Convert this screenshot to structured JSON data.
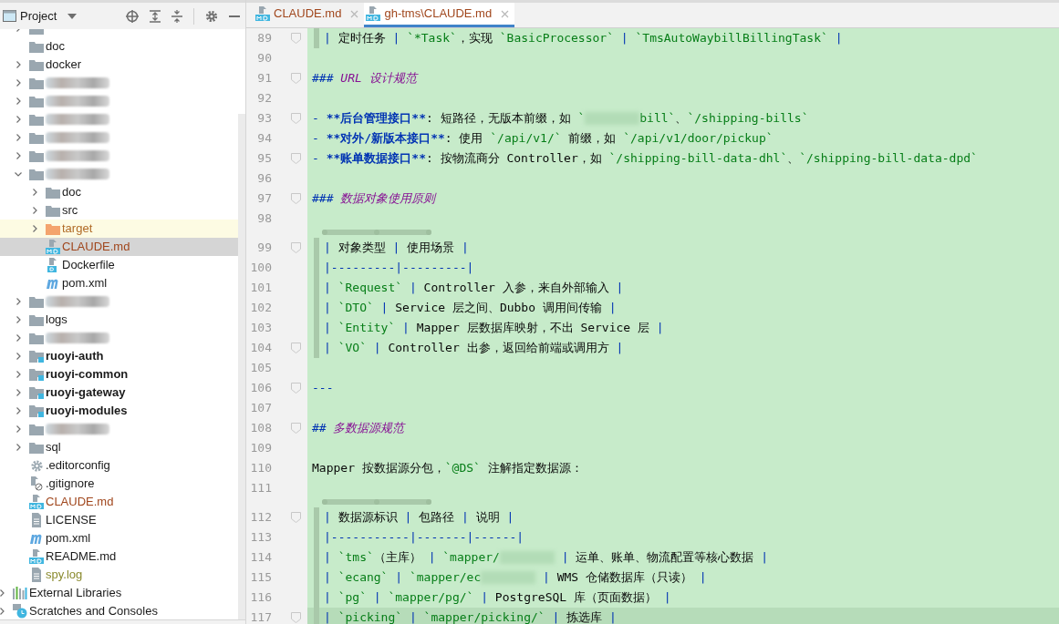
{
  "project_panel": {
    "title": "Project"
  },
  "tree": {
    "project_children": [
      {
        "kind": "folder",
        "expanded": false,
        "selected": false,
        "highlighted": false
      },
      {
        "label": "doc",
        "kind": "folder",
        "selected": false,
        "highlighted": false
      },
      {
        "label": "docker",
        "kind": "folder",
        "expanded": false,
        "selected": false,
        "highlighted": false
      },
      {
        "kind": "redacted",
        "expanded": false,
        "selected": false,
        "highlighted": false
      },
      {
        "kind": "redacted",
        "expanded": false,
        "selected": false,
        "highlighted": false
      },
      {
        "kind": "redacted",
        "expanded": false,
        "selected": false,
        "highlighted": false
      },
      {
        "kind": "redacted",
        "expanded": false,
        "selected": false,
        "highlighted": false
      },
      {
        "kind": "redacted",
        "expanded": false,
        "selected": false,
        "highlighted": false
      },
      {
        "kind": "redacted",
        "expanded": true,
        "selected": false,
        "highlighted": false,
        "children": [
          {
            "label": "doc",
            "kind": "folder",
            "expanded": false,
            "selected": false,
            "highlighted": false
          },
          {
            "label": "src",
            "kind": "folder",
            "expanded": false,
            "selected": false,
            "highlighted": false
          },
          {
            "label": "target",
            "kind": "excluded-folder",
            "expanded": false,
            "selected": false,
            "highlighted": true,
            "color": "#b06a25"
          },
          {
            "label": "CLAUDE.md",
            "kind": "markdown",
            "selected": true,
            "highlighted": false,
            "color": "#a0461c"
          },
          {
            "label": "Dockerfile",
            "kind": "docker",
            "selected": false,
            "highlighted": false
          },
          {
            "label": "pom.xml",
            "kind": "maven",
            "selected": false,
            "highlighted": false
          }
        ]
      },
      {
        "kind": "redacted",
        "expanded": false,
        "selected": false,
        "highlighted": false
      },
      {
        "label": "logs",
        "kind": "folder",
        "expanded": false,
        "selected": false,
        "highlighted": false
      },
      {
        "kind": "redacted",
        "expanded": false,
        "selected": false,
        "highlighted": false
      },
      {
        "label": "ruoyi-auth",
        "kind": "module",
        "expanded": false,
        "selected": false,
        "highlighted": false
      },
      {
        "label": "ruoyi-common",
        "kind": "module",
        "expanded": false,
        "selected": false,
        "highlighted": false
      },
      {
        "label": "ruoyi-gateway",
        "kind": "module",
        "expanded": false,
        "selected": false,
        "highlighted": false
      },
      {
        "label": "ruoyi-modules",
        "kind": "module",
        "expanded": false,
        "selected": false,
        "highlighted": false
      },
      {
        "kind": "redacted",
        "expanded": false,
        "selected": false,
        "highlighted": false
      },
      {
        "label": "sql",
        "kind": "folder",
        "expanded": false,
        "selected": false,
        "highlighted": false
      },
      {
        "label": ".editorconfig",
        "kind": "config",
        "selected": false,
        "highlighted": false
      },
      {
        "label": ".gitignore",
        "kind": "ignore",
        "selected": false,
        "highlighted": false
      },
      {
        "label": "CLAUDE.md",
        "kind": "markdown",
        "selected": false,
        "highlighted": false,
        "color": "#a0461c"
      },
      {
        "label": "LICENSE",
        "kind": "text",
        "selected": false,
        "highlighted": false
      },
      {
        "label": "pom.xml",
        "kind": "maven",
        "selected": false,
        "highlighted": false
      },
      {
        "label": "README.md",
        "kind": "markdown",
        "selected": false,
        "highlighted": false
      },
      {
        "label": "spy.log",
        "kind": "text",
        "selected": false,
        "highlighted": false,
        "color": "#8a8a2e"
      }
    ],
    "other_roots": [
      {
        "label": "External Libraries",
        "kind": "libraries",
        "expanded": false,
        "selected": false,
        "highlighted": false
      },
      {
        "label": "Scratches and Consoles",
        "kind": "scratches",
        "expanded": false,
        "selected": false,
        "highlighted": false
      }
    ]
  },
  "tabs": [
    {
      "label": "CLAUDE.md",
      "selected": false
    },
    {
      "label": "gh-tms\\CLAUDE.md",
      "selected": true
    }
  ],
  "editor": {
    "lines": [
      {
        "number": "89",
        "table": true,
        "table_start": false,
        "fold": true,
        "current": false,
        "segments": [
          {
            "kind": "pipe",
            "text": "| "
          },
          {
            "kind": "text",
            "text": "定时任务 "
          },
          {
            "kind": "pipe",
            "text": "| "
          },
          {
            "kind": "code",
            "text": "`*Task`"
          },
          {
            "kind": "text",
            "text": "，实现 "
          },
          {
            "kind": "code",
            "text": "`BasicProcessor`"
          },
          {
            "kind": "pipe",
            "text": " | "
          },
          {
            "kind": "code",
            "text": "`TmsAutoWaybillBillingTask`"
          },
          {
            "kind": "pipe",
            "text": " |"
          }
        ]
      },
      {
        "number": "90",
        "table": false,
        "table_start": false,
        "fold": false,
        "current": false
      },
      {
        "number": "91",
        "table": false,
        "table_start": false,
        "fold": true,
        "current": false,
        "segments": [
          {
            "kind": "hash",
            "text": "### "
          },
          {
            "kind": "heading",
            "text": "URL 设计规范"
          }
        ]
      },
      {
        "number": "92",
        "table": false,
        "table_start": false,
        "fold": false,
        "current": false
      },
      {
        "number": "93",
        "table": false,
        "table_start": false,
        "fold": true,
        "current": false,
        "segments": [
          {
            "kind": "hash",
            "text": "- "
          },
          {
            "kind": "strong",
            "text": "**后台管理接口**"
          },
          {
            "kind": "text",
            "text": ": 短路径，无版本前缀，如 "
          },
          {
            "kind": "code",
            "text": "`"
          },
          {
            "kind": "redacted"
          },
          {
            "kind": "code",
            "text": "bill`"
          },
          {
            "kind": "text",
            "text": "、"
          },
          {
            "kind": "code",
            "text": "`/shipping-bills`"
          }
        ]
      },
      {
        "number": "94",
        "table": false,
        "table_start": false,
        "fold": false,
        "current": false,
        "segments": [
          {
            "kind": "hash",
            "text": "- "
          },
          {
            "kind": "strong",
            "text": "**对外/新版本接口**"
          },
          {
            "kind": "text",
            "text": ": 使用 "
          },
          {
            "kind": "code",
            "text": "`/api/v1/`"
          },
          {
            "kind": "text",
            "text": " 前缀，如 "
          },
          {
            "kind": "code",
            "text": "`/api/v1/door/pickup`"
          }
        ]
      },
      {
        "number": "95",
        "table": false,
        "table_start": false,
        "fold": true,
        "current": false,
        "segments": [
          {
            "kind": "hash",
            "text": "- "
          },
          {
            "kind": "strong",
            "text": "**账单数据接口**"
          },
          {
            "kind": "text",
            "text": ": 按物流商分 Controller，如 "
          },
          {
            "kind": "code",
            "text": "`/shipping-bill-data-dhl`"
          },
          {
            "kind": "text",
            "text": "、"
          },
          {
            "kind": "code",
            "text": "`/shipping-bill-data-dpd`"
          }
        ]
      },
      {
        "number": "96",
        "table": false,
        "table_start": false,
        "fold": false,
        "current": false
      },
      {
        "number": "97",
        "table": false,
        "table_start": false,
        "fold": true,
        "current": false,
        "segments": [
          {
            "kind": "hash",
            "text": "### "
          },
          {
            "kind": "heading",
            "text": "数据对象使用原则"
          }
        ]
      },
      {
        "number": "98",
        "table": false,
        "table_start": false,
        "fold": false,
        "current": false
      },
      {
        "number": "99",
        "table": true,
        "table_start": true,
        "fold": true,
        "current": false,
        "segments": [
          {
            "kind": "pipe",
            "text": "| "
          },
          {
            "kind": "text",
            "text": "对象类型 "
          },
          {
            "kind": "pipe",
            "text": "| "
          },
          {
            "kind": "text",
            "text": "使用场景 "
          },
          {
            "kind": "pipe",
            "text": "|"
          }
        ]
      },
      {
        "number": "100",
        "table": true,
        "table_start": false,
        "fold": false,
        "current": false,
        "segments": [
          {
            "kind": "pipe",
            "text": "|---------|---------|"
          }
        ]
      },
      {
        "number": "101",
        "table": true,
        "table_start": false,
        "fold": false,
        "current": false,
        "segments": [
          {
            "kind": "pipe",
            "text": "| "
          },
          {
            "kind": "code",
            "text": "`Request`"
          },
          {
            "kind": "pipe",
            "text": " | "
          },
          {
            "kind": "text",
            "text": "Controller 入参，来自外部输入 "
          },
          {
            "kind": "pipe",
            "text": "|"
          }
        ]
      },
      {
        "number": "102",
        "table": true,
        "table_start": false,
        "fold": false,
        "current": false,
        "segments": [
          {
            "kind": "pipe",
            "text": "| "
          },
          {
            "kind": "code",
            "text": "`DTO`"
          },
          {
            "kind": "pipe",
            "text": " | "
          },
          {
            "kind": "text",
            "text": "Service 层之间、Dubbo 调用间传输 "
          },
          {
            "kind": "pipe",
            "text": "|"
          }
        ]
      },
      {
        "number": "103",
        "table": true,
        "table_start": false,
        "fold": false,
        "current": false,
        "segments": [
          {
            "kind": "pipe",
            "text": "| "
          },
          {
            "kind": "code",
            "text": "`Entity`"
          },
          {
            "kind": "pipe",
            "text": " | "
          },
          {
            "kind": "text",
            "text": "Mapper 层数据库映射，不出 Service 层 "
          },
          {
            "kind": "pipe",
            "text": "|"
          }
        ]
      },
      {
        "number": "104",
        "table": true,
        "table_start": false,
        "fold": true,
        "current": false,
        "segments": [
          {
            "kind": "pipe",
            "text": "| "
          },
          {
            "kind": "code",
            "text": "`VO`"
          },
          {
            "kind": "pipe",
            "text": " | "
          },
          {
            "kind": "text",
            "text": "Controller 出参，返回给前端或调用方 "
          },
          {
            "kind": "pipe",
            "text": "|"
          }
        ]
      },
      {
        "number": "105",
        "table": false,
        "table_start": false,
        "fold": false,
        "current": false
      },
      {
        "number": "106",
        "table": false,
        "table_start": false,
        "fold": true,
        "current": false,
        "segments": [
          {
            "kind": "hash",
            "text": "---"
          }
        ]
      },
      {
        "number": "107",
        "table": false,
        "table_start": false,
        "fold": false,
        "current": false
      },
      {
        "number": "108",
        "table": false,
        "table_start": false,
        "fold": true,
        "current": false,
        "segments": [
          {
            "kind": "hash",
            "text": "## "
          },
          {
            "kind": "heading",
            "text": "多数据源规范"
          }
        ]
      },
      {
        "number": "109",
        "table": false,
        "table_start": false,
        "fold": false,
        "current": false
      },
      {
        "number": "110",
        "table": false,
        "table_start": false,
        "fold": false,
        "current": false,
        "segments": [
          {
            "kind": "text",
            "text": "Mapper 按数据源分包，"
          },
          {
            "kind": "code",
            "text": "`@DS`"
          },
          {
            "kind": "text",
            "text": " 注解指定数据源："
          }
        ]
      },
      {
        "number": "111",
        "table": false,
        "table_start": false,
        "fold": false,
        "current": false
      },
      {
        "number": "112",
        "table": true,
        "table_start": true,
        "fold": true,
        "current": false,
        "segments": [
          {
            "kind": "pipe",
            "text": "| "
          },
          {
            "kind": "text",
            "text": "数据源标识 "
          },
          {
            "kind": "pipe",
            "text": "| "
          },
          {
            "kind": "text",
            "text": "包路径 "
          },
          {
            "kind": "pipe",
            "text": "| "
          },
          {
            "kind": "text",
            "text": "说明 "
          },
          {
            "kind": "pipe",
            "text": "|"
          }
        ]
      },
      {
        "number": "113",
        "table": true,
        "table_start": false,
        "fold": false,
        "current": false,
        "segments": [
          {
            "kind": "pipe",
            "text": "|-----------|-------|------|"
          }
        ]
      },
      {
        "number": "114",
        "table": true,
        "table_start": false,
        "fold": false,
        "current": false,
        "segments": [
          {
            "kind": "pipe",
            "text": "| "
          },
          {
            "kind": "code",
            "text": "`tms`"
          },
          {
            "kind": "text",
            "text": "（主库） "
          },
          {
            "kind": "pipe",
            "text": "| "
          },
          {
            "kind": "code",
            "text": "`mapper/"
          },
          {
            "kind": "redacted"
          },
          {
            "kind": "pipe",
            "text": " | "
          },
          {
            "kind": "text",
            "text": "运单、账单、物流配置等核心数据 "
          },
          {
            "kind": "pipe",
            "text": "|"
          }
        ]
      },
      {
        "number": "115",
        "table": true,
        "table_start": false,
        "fold": false,
        "current": false,
        "segments": [
          {
            "kind": "pipe",
            "text": "| "
          },
          {
            "kind": "code",
            "text": "`ecang`"
          },
          {
            "kind": "pipe",
            "text": " | "
          },
          {
            "kind": "code",
            "text": "`mapper/ec"
          },
          {
            "kind": "redacted"
          },
          {
            "kind": "pipe",
            "text": " | "
          },
          {
            "kind": "text",
            "text": "WMS 仓储数据库（只读） "
          },
          {
            "kind": "pipe",
            "text": "|"
          }
        ]
      },
      {
        "number": "116",
        "table": true,
        "table_start": false,
        "fold": false,
        "current": false,
        "segments": [
          {
            "kind": "pipe",
            "text": "| "
          },
          {
            "kind": "code",
            "text": "`pg`"
          },
          {
            "kind": "pipe",
            "text": " | "
          },
          {
            "kind": "code",
            "text": "`mapper/pg/`"
          },
          {
            "kind": "pipe",
            "text": " | "
          },
          {
            "kind": "text",
            "text": "PostgreSQL 库（页面数据） "
          },
          {
            "kind": "pipe",
            "text": "|"
          }
        ]
      },
      {
        "number": "117",
        "table": true,
        "table_start": false,
        "fold": true,
        "current": true,
        "segments": [
          {
            "kind": "pipe",
            "text": "| "
          },
          {
            "kind": "code",
            "text": "`picking`"
          },
          {
            "kind": "pipe",
            "text": " | "
          },
          {
            "kind": "code",
            "text": "`mapper/picking/`"
          },
          {
            "kind": "pipe",
            "text": " | "
          },
          {
            "kind": "text",
            "text": "拣选库 "
          },
          {
            "kind": "pipe",
            "text": "|"
          }
        ]
      }
    ]
  }
}
